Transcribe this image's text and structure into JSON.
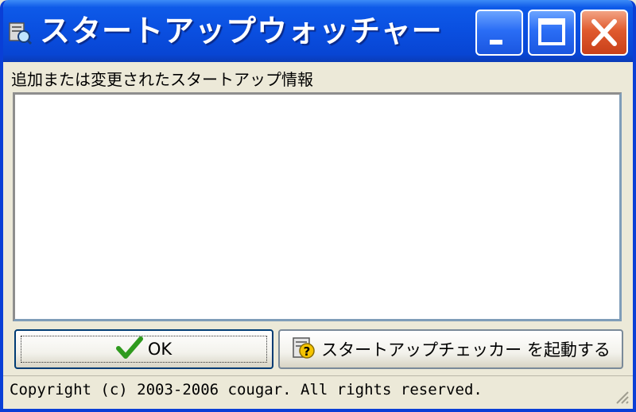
{
  "window": {
    "title": "スタートアップウォッチャー",
    "minimize_icon": "minimize-icon",
    "maximize_icon": "maximize-icon",
    "close_icon": "close-icon"
  },
  "main": {
    "list_label": "追加または変更されたスタートアップ情報",
    "list_items": []
  },
  "buttons": {
    "ok_label": "OK",
    "ok_icon": "checkmark-icon",
    "checker_label": "スタートアップチェッカー を起動する",
    "checker_icon": "help-app-icon"
  },
  "statusbar": {
    "text": "Copyright (c) 2003-2006 cougar. All rights reserved."
  },
  "colors": {
    "titlebar": "#0a4fe0",
    "close": "#e05a2e",
    "face": "#ece9d8",
    "check": "#2f9a1e"
  }
}
